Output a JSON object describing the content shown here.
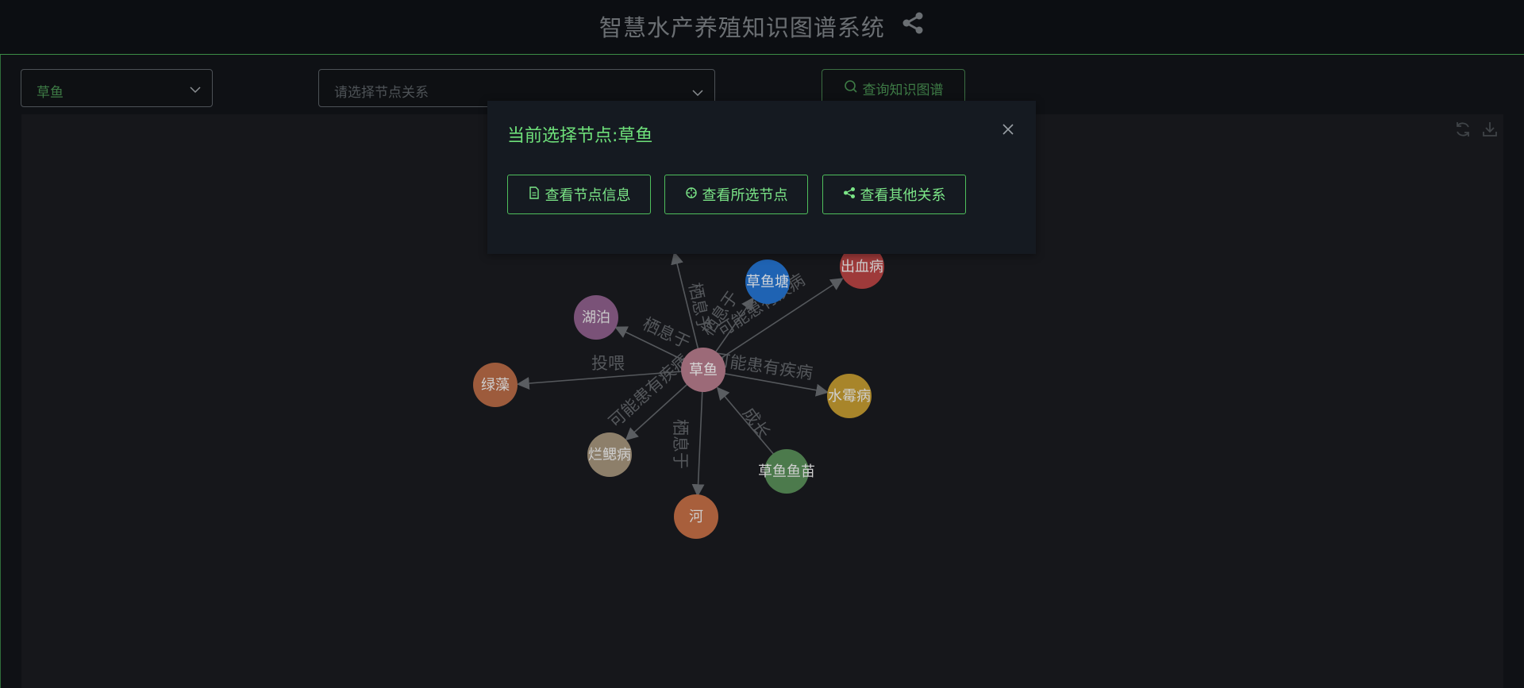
{
  "header": {
    "title": "智慧水产养殖知识图谱系统",
    "icon": "share-icon"
  },
  "toolbar": {
    "node_select_value": "草鱼",
    "relation_select_placeholder": "请选择节点关系",
    "query_button_label": "查询知识图谱"
  },
  "graph": {
    "center_node": "草鱼",
    "nodes": [
      "草鱼",
      "草鱼塘",
      "出血病",
      "湖泊",
      "绿藻",
      "水霉病",
      "烂鳃病",
      "草鱼鱼苗",
      "河"
    ],
    "edge_labels": [
      "栖息于",
      "栖息于",
      "栖息于",
      "栖息于",
      "可能患有疾病",
      "可能患有疾病",
      "可能患有疾病",
      "投喂",
      "成长"
    ],
    "colors": {
      "center": "#9c6a78",
      "pond": "#1f63b3",
      "bleeding": "#9e3a3a",
      "lake": "#7a5278",
      "algae": "#9d5b3c",
      "mold": "#a8852a",
      "gill": "#8d7f6a",
      "fry": "#4c7a4c",
      "river": "#a85f3c"
    }
  },
  "panel_tools": [
    "refresh-icon",
    "download-icon"
  ],
  "modal": {
    "title": "当前选择节点:草鱼",
    "buttons": [
      "查看节点信息",
      "查看所选节点",
      "查看其他关系"
    ],
    "button_icons": [
      "document-icon",
      "target-icon",
      "share-icon"
    ],
    "accent": "#6ee07a"
  }
}
